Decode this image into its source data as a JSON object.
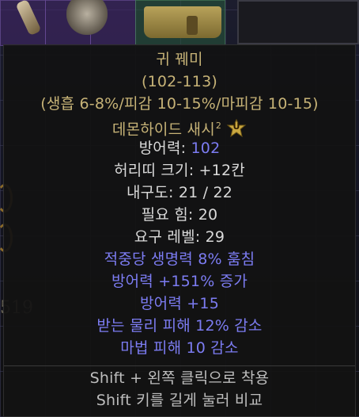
{
  "background": {
    "gold_amount_fragment": "519"
  },
  "tooltip": {
    "item_name": "귀 꿰미",
    "range_line": "(102-113)",
    "affix_summary": "(생흡 6-8%/피감 10-15%/마피감 10-15)",
    "base_type": "데몬하이드 새시",
    "base_tier_mark": "2",
    "tier_badge_letter": "U",
    "defense_label": "방어력: ",
    "defense_value": "102",
    "belt_size": "허리띠 크기: +12칸",
    "durability": "내구도: 21 / 22",
    "required_strength": "필요 힘: 20",
    "required_level": "요구 레벨: 29",
    "mods": [
      "적중당 생명력 8% 훔침",
      "방어력 +151% 증가",
      "방어력 +15",
      "받는 물리 피해 12% 감소",
      "마법 피해 10 감소"
    ],
    "hints": [
      "Shift + 왼쪽 클릭으로 착용",
      "Shift 키를 길게 눌러 비교"
    ]
  },
  "colors": {
    "title_gold": "#c7b377",
    "magic_blue": "#7c7cf2",
    "text_white": "#dadada",
    "hint_grey": "#bdbdbd"
  }
}
